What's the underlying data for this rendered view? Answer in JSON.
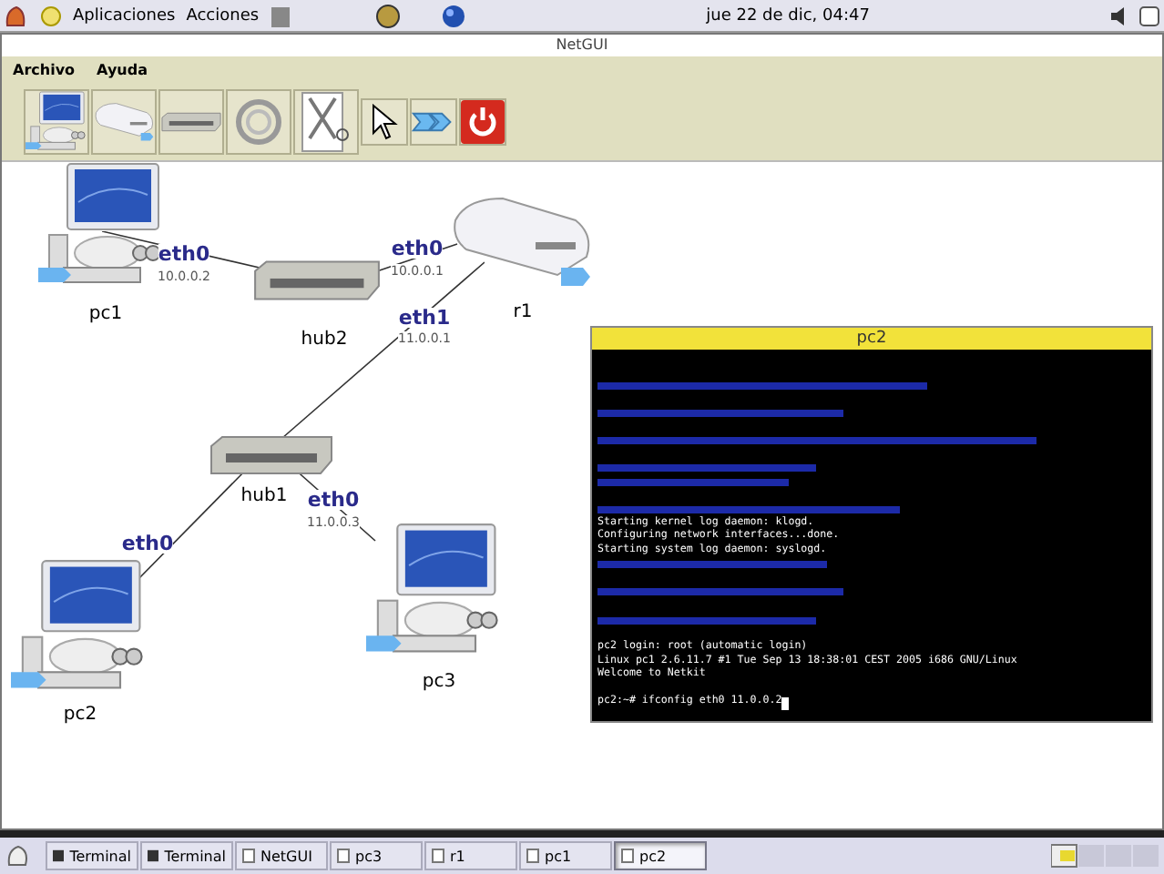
{
  "top_panel": {
    "menus": [
      "Aplicaciones",
      "Acciones"
    ],
    "clock": "jue 22 de dic, 04:47"
  },
  "window": {
    "title": "NetGUI"
  },
  "menu": [
    "Archivo",
    "Ayuda"
  ],
  "toolbar": [
    {
      "kind": "pc"
    },
    {
      "kind": "router"
    },
    {
      "kind": "hub"
    },
    {
      "kind": "cable"
    },
    {
      "kind": "scissors"
    },
    {
      "kind": "pointer"
    },
    {
      "kind": "start"
    },
    {
      "kind": "stop"
    }
  ],
  "network": {
    "nodes": [
      {
        "kind": "pc",
        "name": "pc1"
      },
      {
        "kind": "hub",
        "name": "hub2"
      },
      {
        "kind": "router",
        "name": "r1"
      },
      {
        "kind": "hub",
        "name": "hub1"
      },
      {
        "kind": "pc",
        "name": "pc2"
      },
      {
        "kind": "pc",
        "name": "pc3"
      }
    ],
    "interfaces": [
      {
        "name": "eth0",
        "ip": "10.0.0.2"
      },
      {
        "name": "eth0",
        "ip": "10.0.0.1"
      },
      {
        "name": "eth1",
        "ip": "11.0.0.1"
      },
      {
        "name": "eth0",
        "ip": "11.0.0.3"
      },
      {
        "name": "eth0"
      }
    ]
  },
  "terminal": {
    "title": "pc2",
    "lines": [
      {
        "kind": "blurred"
      },
      {
        "kind": "blank"
      },
      {
        "kind": "blurred"
      },
      {
        "kind": "blank"
      },
      {
        "kind": "blurred"
      },
      {
        "kind": "blank"
      },
      {
        "kind": "blurred"
      },
      {
        "kind": "blurred"
      },
      {
        "kind": "blank"
      },
      {
        "kind": "blurred"
      },
      {
        "kind": "text",
        "text": "Starting kernel log daemon: klogd."
      },
      {
        "kind": "text",
        "text": "Configuring network interfaces...done."
      },
      {
        "kind": "text",
        "text": "Starting system log daemon: syslogd."
      },
      {
        "kind": "blurred"
      },
      {
        "kind": "blank"
      },
      {
        "kind": "blurred"
      },
      {
        "kind": "blank"
      },
      {
        "kind": "blurred"
      },
      {
        "kind": "blank"
      },
      {
        "kind": "text",
        "text": "pc2 login: root (automatic login)"
      },
      {
        "kind": "text",
        "text": "Linux pc1 2.6.11.7 #1 Tue Sep 13 18:38:01 CEST 2005 i686 GNU/Linux"
      },
      {
        "kind": "text",
        "text": "Welcome to Netkit"
      },
      {
        "kind": "blank"
      },
      {
        "kind": "prompt",
        "text": "pc2:~# ifconfig eth0 11.0.0.2"
      }
    ]
  },
  "taskbar": [
    {
      "kind": "terminal",
      "label": "Terminal",
      "selected": false
    },
    {
      "kind": "terminal",
      "label": "Terminal",
      "selected": false
    },
    {
      "kind": "window",
      "label": "NetGUI",
      "selected": false
    },
    {
      "kind": "window",
      "label": "pc3",
      "selected": false
    },
    {
      "kind": "window",
      "label": "r1",
      "selected": false
    },
    {
      "kind": "window",
      "label": "pc1",
      "selected": false
    },
    {
      "kind": "window",
      "label": "pc2",
      "selected": true
    }
  ]
}
